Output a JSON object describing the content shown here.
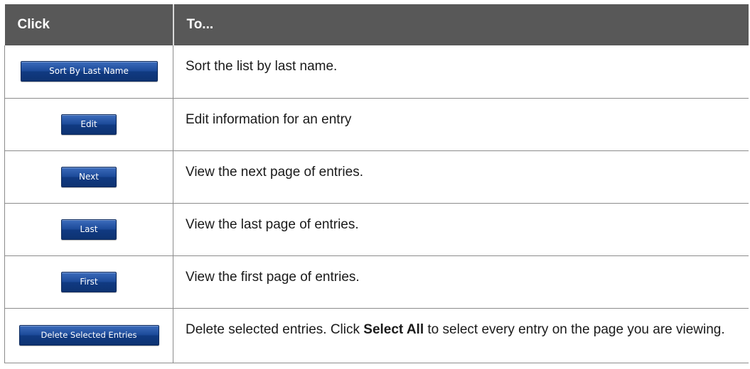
{
  "table": {
    "header": {
      "click": "Click",
      "to": "To..."
    },
    "rows": [
      {
        "button_label": "Sort By Last Name",
        "description": "Sort the list by last name."
      },
      {
        "button_label": "Edit",
        "description": "Edit information for an entry"
      },
      {
        "button_label": "Next",
        "description": "View the next page of entries."
      },
      {
        "button_label": "Last",
        "description": "View the last page of entries."
      },
      {
        "button_label": "First",
        "description": "View the first page of entries."
      },
      {
        "button_label": "Delete Selected Entries",
        "description_before": "Delete selected entries. Click ",
        "description_bold": "Select All",
        "description_after": " to select every entry on the page you are viewing."
      }
    ]
  },
  "colors": {
    "header_background": "#585858",
    "header_text": "#ffffff",
    "button_blue": "#1c4a99",
    "row_border": "#8c8c8c"
  }
}
